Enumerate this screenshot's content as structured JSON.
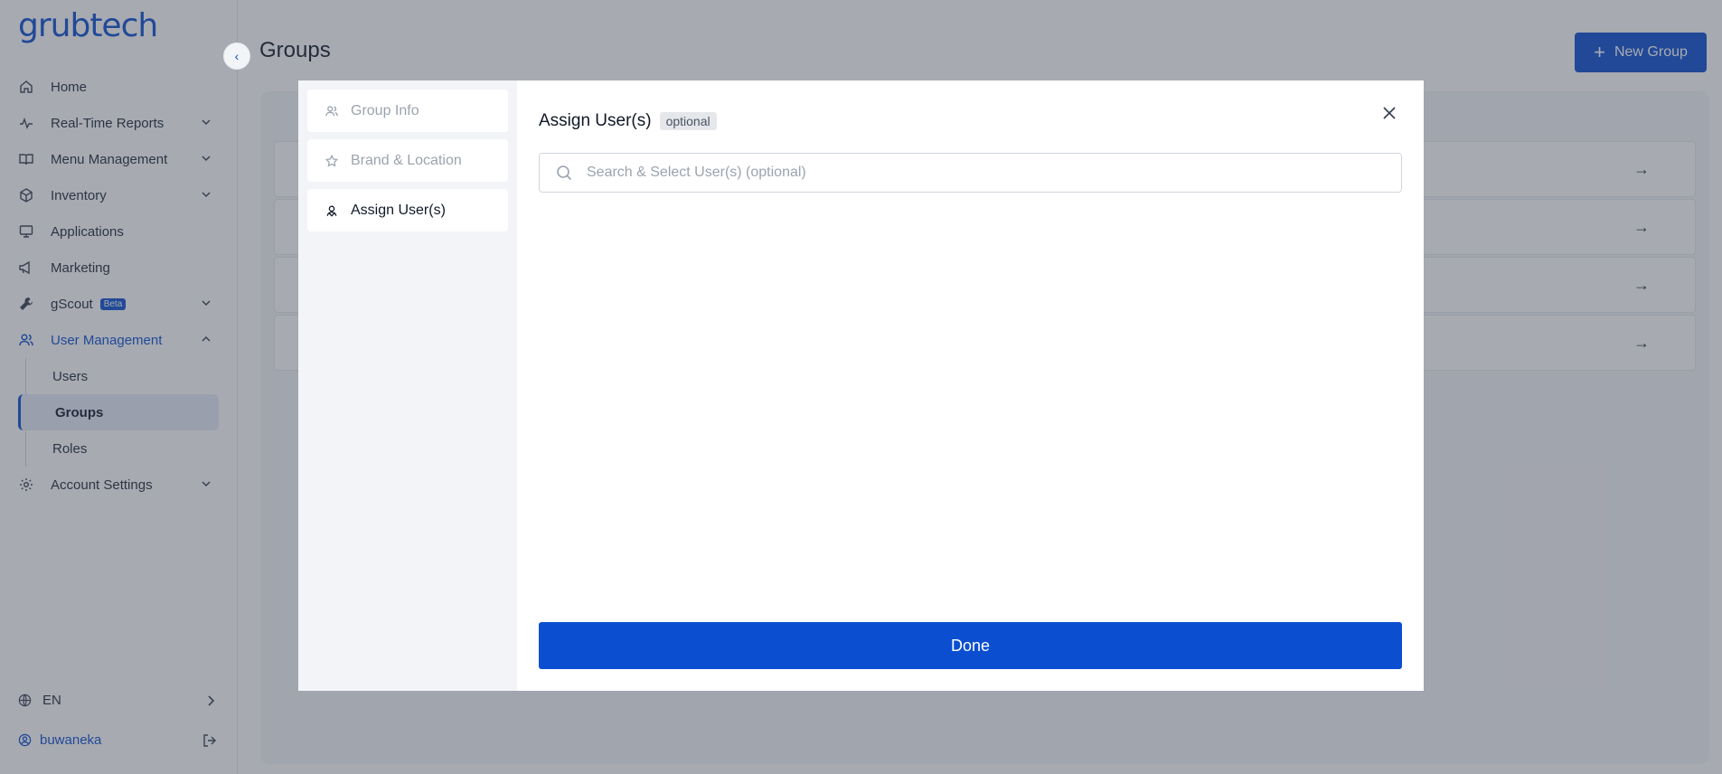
{
  "brand": {
    "logo": "grubtech",
    "accent": "#0b4fd0"
  },
  "sidebar": {
    "items": [
      {
        "label": "Home",
        "icon": "home-icon"
      },
      {
        "label": "Real-Time Reports",
        "icon": "activity-icon"
      },
      {
        "label": "Menu Management",
        "icon": "book-icon"
      },
      {
        "label": "Inventory",
        "icon": "box-icon"
      },
      {
        "label": "Applications",
        "icon": "monitor-icon"
      },
      {
        "label": "Marketing",
        "icon": "megaphone-icon"
      },
      {
        "label": "gScout",
        "icon": "wrench-icon",
        "badge": "Beta"
      },
      {
        "label": "User Management",
        "icon": "users-icon"
      },
      {
        "label": "Account Settings",
        "icon": "gear-icon"
      }
    ],
    "sub_items": [
      "Users",
      "Groups",
      "Roles"
    ],
    "language": "EN",
    "username": "buwaneka"
  },
  "header": {
    "title": "Groups",
    "new_button": "New Group"
  },
  "modal": {
    "steps": [
      "Group Info",
      "Brand & Location",
      "Assign User(s)"
    ],
    "title": "Assign User(s)",
    "badge": "optional",
    "search_placeholder": "Search & Select User(s) (optional)",
    "done_label": "Done"
  }
}
